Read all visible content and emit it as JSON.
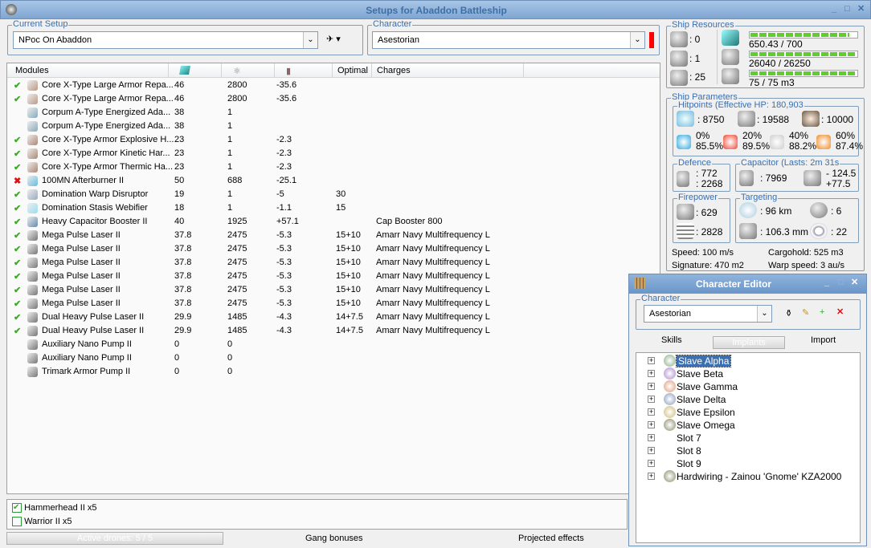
{
  "window": {
    "title": "Setups for Abaddon Battleship"
  },
  "setup": {
    "legend": "Current Setup",
    "value": "NPoc On Abaddon"
  },
  "character": {
    "legend": "Character",
    "value": "Asestorian"
  },
  "modules": {
    "headers": [
      "Modules",
      "",
      "",
      "",
      "Optimal",
      "Charges"
    ],
    "rows": [
      {
        "status": "on",
        "name": "Core X-Type Large Armor Repa...",
        "cpu": "46",
        "pg": "2800",
        "cap": "-35.6",
        "optimal": "",
        "charges": ""
      },
      {
        "status": "on",
        "name": "Core X-Type Large Armor Repa...",
        "cpu": "46",
        "pg": "2800",
        "cap": "-35.6",
        "optimal": "",
        "charges": ""
      },
      {
        "status": "",
        "name": "Corpum A-Type Energized Ada...",
        "cpu": "38",
        "pg": "1",
        "cap": "",
        "optimal": "",
        "charges": ""
      },
      {
        "status": "",
        "name": "Corpum A-Type Energized Ada...",
        "cpu": "38",
        "pg": "1",
        "cap": "",
        "optimal": "",
        "charges": ""
      },
      {
        "status": "on",
        "name": "Core X-Type Armor Explosive H...",
        "cpu": "23",
        "pg": "1",
        "cap": "-2.3",
        "optimal": "",
        "charges": ""
      },
      {
        "status": "on",
        "name": "Core X-Type Armor Kinetic Har...",
        "cpu": "23",
        "pg": "1",
        "cap": "-2.3",
        "optimal": "",
        "charges": ""
      },
      {
        "status": "on",
        "name": "Core X-Type Armor Thermic Ha...",
        "cpu": "23",
        "pg": "1",
        "cap": "-2.3",
        "optimal": "",
        "charges": ""
      },
      {
        "status": "off",
        "name": "100MN Afterburner II",
        "cpu": "50",
        "pg": "688",
        "cap": "-25.1",
        "optimal": "",
        "charges": ""
      },
      {
        "status": "on",
        "name": "Domination Warp Disruptor",
        "cpu": "19",
        "pg": "1",
        "cap": "-5",
        "optimal": "30",
        "charges": ""
      },
      {
        "status": "on",
        "name": "Domination Stasis Webifier",
        "cpu": "18",
        "pg": "1",
        "cap": "-1.1",
        "optimal": "15",
        "charges": ""
      },
      {
        "status": "on",
        "name": "Heavy Capacitor Booster II",
        "cpu": "40",
        "pg": "1925",
        "cap": "+57.1",
        "optimal": "",
        "charges": "Cap Booster 800"
      },
      {
        "status": "on",
        "name": "Mega Pulse Laser II",
        "cpu": "37.8",
        "pg": "2475",
        "cap": "-5.3",
        "optimal": "15+10",
        "charges": "Amarr Navy Multifrequency L"
      },
      {
        "status": "on",
        "name": "Mega Pulse Laser II",
        "cpu": "37.8",
        "pg": "2475",
        "cap": "-5.3",
        "optimal": "15+10",
        "charges": "Amarr Navy Multifrequency L"
      },
      {
        "status": "on",
        "name": "Mega Pulse Laser II",
        "cpu": "37.8",
        "pg": "2475",
        "cap": "-5.3",
        "optimal": "15+10",
        "charges": "Amarr Navy Multifrequency L"
      },
      {
        "status": "on",
        "name": "Mega Pulse Laser II",
        "cpu": "37.8",
        "pg": "2475",
        "cap": "-5.3",
        "optimal": "15+10",
        "charges": "Amarr Navy Multifrequency L"
      },
      {
        "status": "on",
        "name": "Mega Pulse Laser II",
        "cpu": "37.8",
        "pg": "2475",
        "cap": "-5.3",
        "optimal": "15+10",
        "charges": "Amarr Navy Multifrequency L"
      },
      {
        "status": "on",
        "name": "Mega Pulse Laser II",
        "cpu": "37.8",
        "pg": "2475",
        "cap": "-5.3",
        "optimal": "15+10",
        "charges": "Amarr Navy Multifrequency L"
      },
      {
        "status": "on",
        "name": "Dual Heavy Pulse Laser II",
        "cpu": "29.9",
        "pg": "1485",
        "cap": "-4.3",
        "optimal": "14+7.5",
        "charges": "Amarr Navy Multifrequency L"
      },
      {
        "status": "on",
        "name": "Dual Heavy Pulse Laser II",
        "cpu": "29.9",
        "pg": "1485",
        "cap": "-4.3",
        "optimal": "14+7.5",
        "charges": "Amarr Navy Multifrequency L"
      },
      {
        "status": "",
        "name": "Auxiliary Nano Pump II",
        "cpu": "0",
        "pg": "0",
        "cap": "",
        "optimal": "",
        "charges": ""
      },
      {
        "status": "",
        "name": "Auxiliary Nano Pump II",
        "cpu": "0",
        "pg": "0",
        "cap": "",
        "optimal": "",
        "charges": ""
      },
      {
        "status": "",
        "name": "Trimark Armor Pump II",
        "cpu": "0",
        "pg": "0",
        "cap": "",
        "optimal": "",
        "charges": ""
      }
    ]
  },
  "drones": [
    {
      "name": "Hammerhead II x5",
      "checked": true
    },
    {
      "name": "Warrior II x5",
      "checked": false
    }
  ],
  "bottom": {
    "active_drones": "Active drones: 5 / 5",
    "gang": "Gang bonuses",
    "projected": "Projected effects"
  },
  "resources": {
    "legend": "Ship Resources",
    "turrets": ": 0",
    "launchers": ": 1",
    "calibration": ": 25",
    "cpu": "650.43 / 700",
    "cpu_fill": 0.93,
    "pg": "26040 / 26250",
    "pg_fill": 0.99,
    "drone": "75 / 75 m3",
    "drone_fill": 1.0
  },
  "params": {
    "legend": "Ship Parameters",
    "hp": {
      "legend": "Hitpoints (Effective HP: 180,903",
      "shield": ": 8750",
      "armor": ": 19588",
      "structure": ": 10000",
      "res": [
        [
          "0%",
          "85.5%"
        ],
        [
          "20%",
          "89.5%"
        ],
        [
          "40%",
          "88.2%"
        ],
        [
          "60%",
          "87.4%"
        ]
      ]
    },
    "defence": {
      "legend": "Defence",
      "a": ": 772",
      "b": ": 2268"
    },
    "capacitor": {
      "legend": "Capacitor (Lasts: 2m 31s",
      "cap": ": 7969",
      "use": "- 124.5",
      "regen": "+77.5"
    },
    "firepower": {
      "legend": "Firepower",
      "a": ": 629",
      "b": ": 2828"
    },
    "targeting": {
      "legend": "Targeting",
      "range": ": 96 km",
      "targets": ": 6",
      "scan": ": 106.3 mm",
      "sensor": ": 22"
    },
    "speed": "Speed: 100 m/s",
    "cargo": "Cargohold: 525 m3",
    "signature": "Signature: 470 m2",
    "warp": "Warp speed: 3 au/s"
  },
  "editor": {
    "title": "Character Editor",
    "legend": "Character",
    "character": "Asestorian",
    "tabs": [
      "Skills",
      "Implants",
      "Import"
    ],
    "implants": [
      "Slave Alpha",
      "Slave Beta",
      "Slave Gamma",
      "Slave Delta",
      "Slave Epsilon",
      "Slave Omega",
      "Slot 7",
      "Slot 8",
      "Slot 9",
      "Hardwiring - Zainou 'Gnome' KZA2000"
    ]
  }
}
